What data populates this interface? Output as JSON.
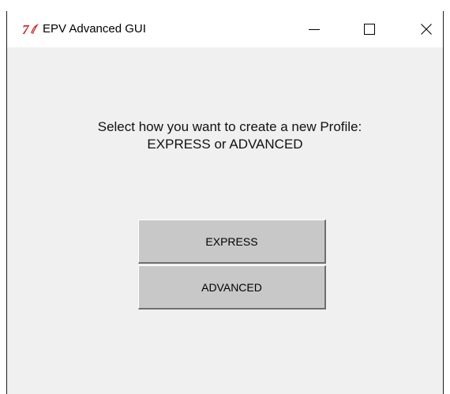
{
  "window": {
    "title": "EPV Advanced GUI",
    "icon": "tk-feather-icon",
    "controls": {
      "minimize": "minimize-icon",
      "maximize": "maximize-icon",
      "close": "close-icon"
    }
  },
  "prompt": {
    "line1": "Select how you want to create a new Profile:",
    "line2": "EXPRESS or ADVANCED"
  },
  "buttons": {
    "express": "EXPRESS",
    "advanced": "ADVANCED"
  },
  "colors": {
    "window_bg": "#f0f0f0",
    "titlebar_bg": "#ffffff",
    "button_bg": "#c8c8c8",
    "icon_red": "#d42020"
  }
}
